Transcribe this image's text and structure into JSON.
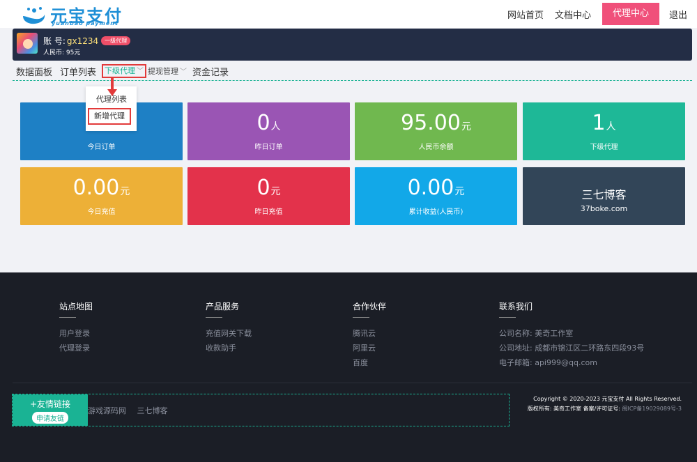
{
  "header": {
    "logo_title": "元宝支付",
    "logo_sub": "yuanbao payment",
    "nav": [
      "网站首页",
      "文档中心"
    ],
    "nav_active": "代理中心",
    "logout": "退出"
  },
  "user": {
    "acct_prefix": "账 号:",
    "acct_name": "gx1234",
    "badge": "一级代理",
    "rmb": "人民币: 95元"
  },
  "menu": {
    "dashboard": "数据面板",
    "orders": "订单列表",
    "agents": "下级代理",
    "withdraw": "提现管理",
    "funds": "资金记录"
  },
  "dropdown": {
    "item1": "代理列表",
    "item2": "新增代理"
  },
  "cards": [
    {
      "value": "",
      "unit": "",
      "label": "今日订单",
      "color": "#1e80c5"
    },
    {
      "value": "0",
      "unit": "人",
      "label": "昨日订单",
      "color": "#9a55b4"
    },
    {
      "value": "95.00",
      "unit": "元",
      "label": "人民币余额",
      "color": "#70b84f"
    },
    {
      "value": "1",
      "unit": "人",
      "label": "下级代理",
      "color": "#1eb897"
    },
    {
      "value": "0.00",
      "unit": "元",
      "label": "今日充值",
      "color": "#edb037"
    },
    {
      "value": "0",
      "unit": "元",
      "label": "昨日充值",
      "color": "#e3324b"
    },
    {
      "value": "0.00",
      "unit": "元",
      "label": "累计收益(人民币)",
      "color": "#12a8e8"
    },
    {
      "title": "三七博客",
      "sub": "37boke.com",
      "color": "#324558"
    }
  ],
  "footer": {
    "cols": [
      {
        "head": "站点地图",
        "items": [
          "用户登录",
          "代理登录"
        ]
      },
      {
        "head": "产品服务",
        "items": [
          "充值网关下载",
          "收款助手"
        ]
      },
      {
        "head": "合作伙伴",
        "items": [
          "腾讯云",
          "阿里云",
          "百度"
        ]
      },
      {
        "head": "联系我们",
        "items": [
          "公司名称: 美奇工作室",
          "公司地址: 成都市锦江区二环路东四段93号",
          "电子邮箱: api999@qq.com"
        ]
      }
    ],
    "friends_title": "+友情链接",
    "friends_apply": "申请友链",
    "friends_links": [
      "游戏源码网",
      "三七博客"
    ],
    "copyright": "Copyright © 2020-2023 元宝支付 All Rights Reserved.",
    "owner": "版权所有: 美奇工作室 备案/许可证号: ",
    "icp": "闽ICP备19029089号-3"
  }
}
